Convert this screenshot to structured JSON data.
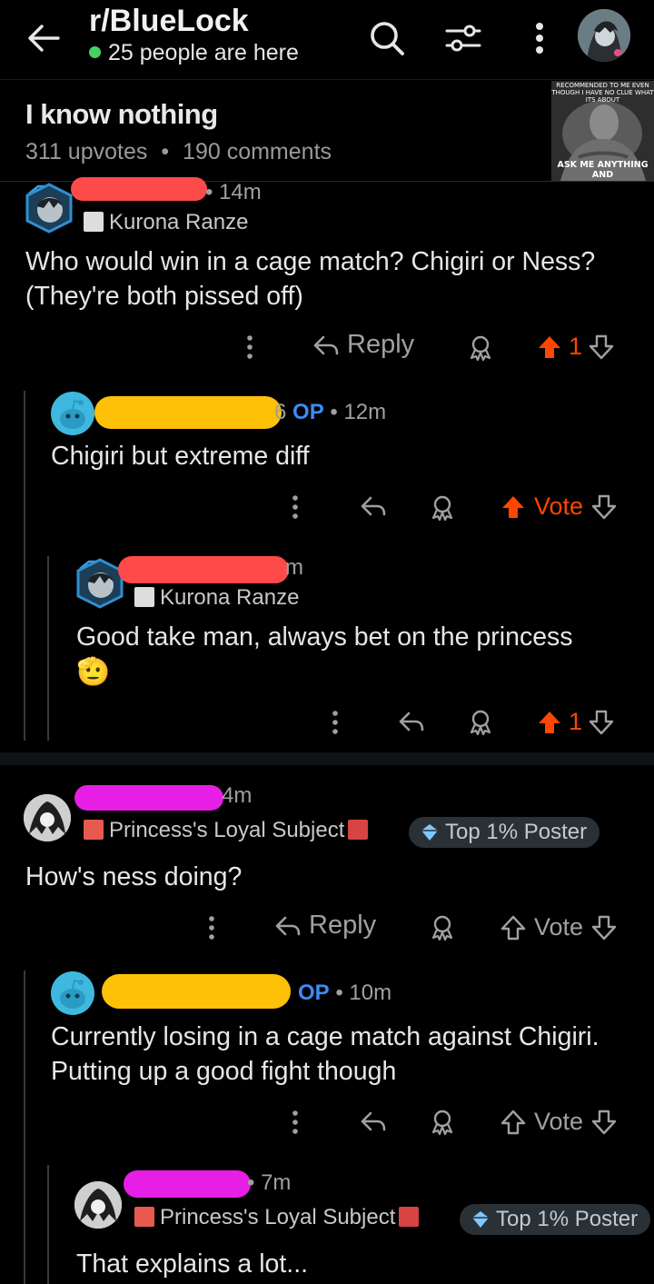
{
  "header": {
    "subreddit": "r/BlueLock",
    "online_text": "25 people are here"
  },
  "post": {
    "title": "I know nothing",
    "upvotes": "311 upvotes",
    "separator": "•",
    "comments": "190 comments",
    "thumbnail_top": "RECOMMENDED TO ME EVEN THOUGH I HAVE NO CLUE WHAT ITS ABOUT",
    "thumbnail_bottom": "ASK ME ANYTHING AND"
  },
  "comments": [
    {
      "time": "• 14m",
      "flair": "Kurona Ranze",
      "body": "Who would win in a cage match? Chigiri or Ness? (They're both pissed off)",
      "reply_label": "Reply",
      "score": "1",
      "vote_state": "up"
    },
    {
      "name_suffix": "6",
      "op_label": "OP",
      "time": "• 12m",
      "body": "Chigiri but extreme diff",
      "vote_label": "Vote",
      "vote_state": "up"
    },
    {
      "time": "m",
      "flair": "Kurona Ranze",
      "body": "Good take man, always bet on the princess",
      "emoji": "🫡",
      "score": "1",
      "vote_state": "up"
    },
    {
      "time": "4m",
      "flair": "Princess's Loyal Subject",
      "badge": "Top 1% Poster",
      "body": "How's ness doing?",
      "reply_label": "Reply",
      "vote_label": "Vote",
      "vote_state": "none"
    },
    {
      "op_label": "OP",
      "time": "• 10m",
      "body": "Currently losing in a cage match against Chigiri. Putting up a good fight though",
      "vote_label": "Vote",
      "vote_state": "none"
    },
    {
      "time": "• 7m",
      "flair": "Princess's Loyal Subject",
      "badge": "Top 1% Poster",
      "body": "That explains a lot..."
    }
  ],
  "colors": {
    "background": "#000000",
    "upvote_active": "#ff4500",
    "op_blue": "#3d8bf5",
    "online_green": "#46d160",
    "redact_red": "#ff4a4a",
    "redact_yellow": "#ffc107",
    "redact_magenta": "#e61ee6"
  },
  "icons": [
    "back-arrow-icon",
    "search-icon",
    "filter-icon",
    "more-vert-icon",
    "reply-icon",
    "award-icon",
    "upvote-icon",
    "downvote-icon",
    "snoo-avatar-icon"
  ]
}
